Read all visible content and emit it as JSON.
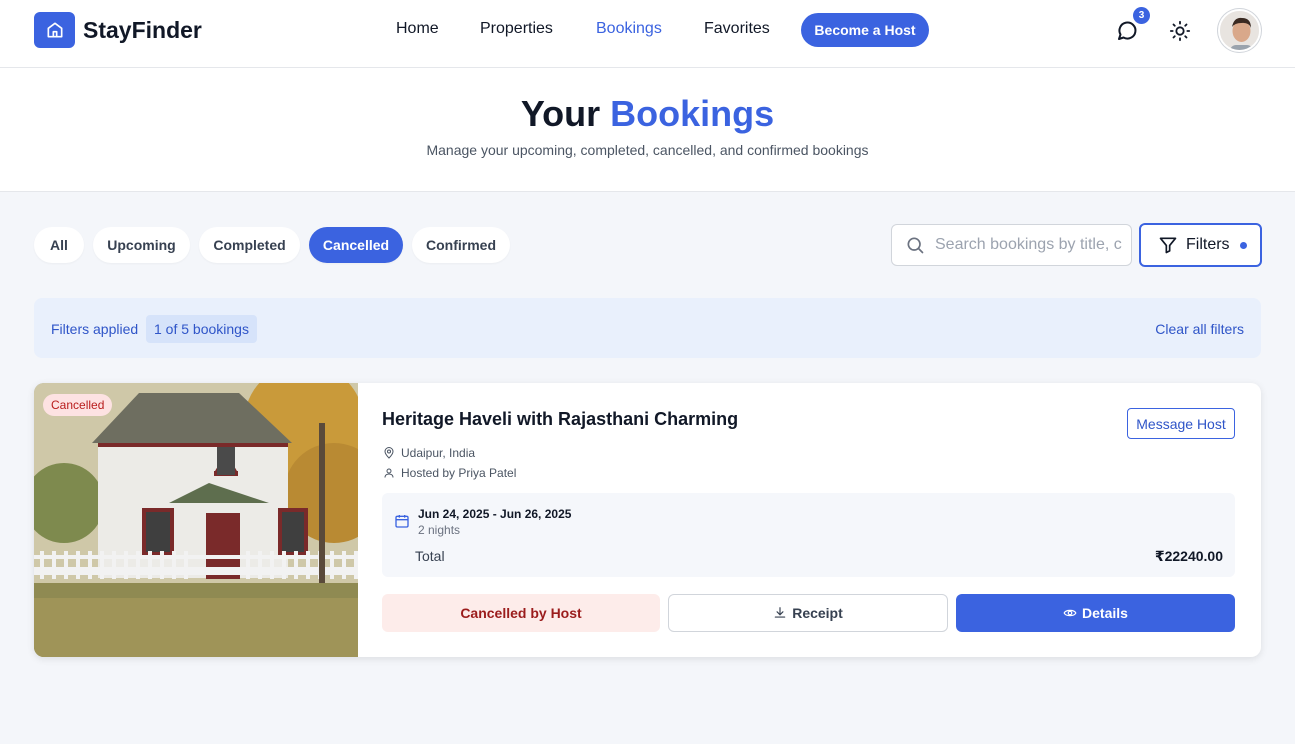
{
  "app": {
    "name": "StayFinder"
  },
  "nav": {
    "home": "Home",
    "properties": "Properties",
    "bookings": "Bookings",
    "favorites": "Favorites",
    "become_host": "Become a Host"
  },
  "notifications": {
    "count": "3"
  },
  "hero": {
    "title_part1": "Your",
    "title_part2": "Bookings",
    "subtitle": "Manage your upcoming, completed, cancelled, and confirmed bookings"
  },
  "tabs": [
    {
      "label": "All",
      "active": false
    },
    {
      "label": "Upcoming",
      "active": false
    },
    {
      "label": "Completed",
      "active": false
    },
    {
      "label": "Cancelled",
      "active": true
    },
    {
      "label": "Confirmed",
      "active": false
    }
  ],
  "search": {
    "placeholder": "Search bookings by title, c",
    "value": ""
  },
  "filters": {
    "label": "Filters",
    "active_indicator": true
  },
  "filter_bar": {
    "label": "Filters applied",
    "count": "1 of 5 bookings",
    "clear": "Clear all filters"
  },
  "booking": {
    "status": "Cancelled",
    "title": "Heritage Haveli with Rajasthani Charming",
    "location": "Udaipur, India",
    "host": "Hosted by Priya Patel",
    "message_host": "Message Host",
    "dates": "Jun 24, 2025 - Jun 26, 2025",
    "nights": "2 nights",
    "total_label": "Total",
    "total_value": "₹22240.00",
    "cancel_status": "Cancelled by Host",
    "receipt": "Receipt",
    "details": "Details"
  },
  "colors": {
    "accent": "#3b63e0",
    "cancel_bg": "#fdecea",
    "cancel_text": "#9b1c1c"
  },
  "icons": [
    "home-icon",
    "chat-icon",
    "sun-icon",
    "search-icon",
    "filter-icon",
    "map-pin-icon",
    "user-icon",
    "calendar-icon",
    "download-icon",
    "eye-icon"
  ]
}
